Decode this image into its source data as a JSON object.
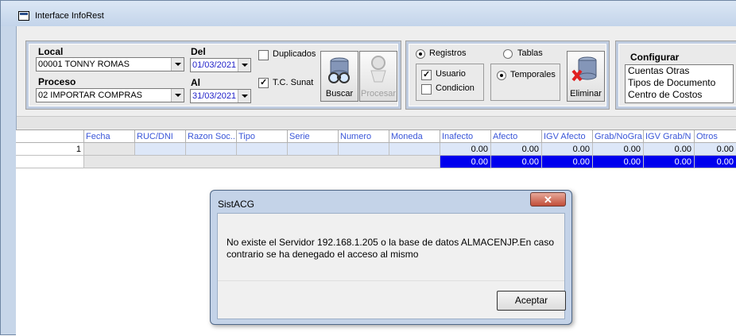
{
  "window": {
    "title": "Interface InfoRest"
  },
  "filters": {
    "local_label": "Local",
    "local_value": "00001 TONNY ROMAS",
    "proceso_label": "Proceso",
    "proceso_value": "02 IMPORTAR COMPRAS",
    "del_label": "Del",
    "del_value": "01/03/2021",
    "al_label": "Al",
    "al_value": "31/03/2021",
    "duplicados_label": "Duplicados",
    "duplicados_checked": false,
    "tc_sunat_label": "T.C. Sunat",
    "tc_sunat_checked": true,
    "buscar_label": "Buscar",
    "procesar_label": "Procesar"
  },
  "mode": {
    "registros_label": "Registros",
    "tablas_label": "Tablas",
    "usuario_label": "Usuario",
    "condicion_label": "Condicion",
    "temporales_label": "Temporales",
    "eliminar_label": "Eliminar"
  },
  "configurar": {
    "title": "Configurar",
    "items": [
      "Cuentas Otras",
      "Tipos de Documento",
      "Centro de Costos"
    ]
  },
  "grid": {
    "columns": [
      "Fecha",
      "RUC/DNI",
      "Razon Soc...",
      "Tipo",
      "Serie",
      "Numero",
      "Moneda",
      "Inafecto",
      "Afecto",
      "IGV Afecto",
      "Grab/NoGra",
      "IGV Grab/N",
      "Otros"
    ],
    "row1_index": "1",
    "row1_values": [
      "0.00",
      "0.00",
      "0.00",
      "0.00",
      "0.00",
      "0.00"
    ],
    "total_values": [
      "0.00",
      "0.00",
      "0.00",
      "0.00",
      "0.00",
      "0.00"
    ]
  },
  "dialog": {
    "title": "SistACG",
    "close_label": "✕",
    "message": "No existe el Servidor 192.168.1.205 o la base de datos ALMACENJP.En caso contrario se ha denegado el acceso al mismo",
    "ok_label": "Aceptar"
  }
}
